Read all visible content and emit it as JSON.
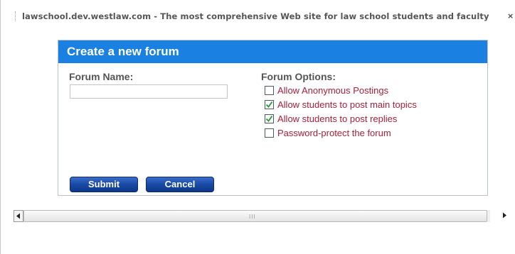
{
  "window": {
    "title": "lawschool.dev.westlaw.com - The most comprehensive Web site for law school students and faculty",
    "close_glyph": "×"
  },
  "form": {
    "title": "Create a new forum",
    "forum_name_label": "Forum Name:",
    "forum_name_value": "",
    "options_label": "Forum Options:",
    "options": [
      {
        "label": "Allow Anonymous Postings",
        "checked": false
      },
      {
        "label": "Allow students to post main topics",
        "checked": true
      },
      {
        "label": "Allow students to post replies",
        "checked": true
      },
      {
        "label": "Password-protect the forum",
        "checked": false
      }
    ],
    "submit_label": "Submit",
    "cancel_label": "Cancel"
  },
  "colors": {
    "header_blue": "#1a80e2",
    "option_text": "#a8203a",
    "check_green": "#2f9a3a",
    "button_blue": "#174aa6"
  },
  "icons": {
    "scroll_left": "chevron-left-icon",
    "scroll_right": "chevron-right-icon",
    "checkmark": "checkmark-icon"
  }
}
